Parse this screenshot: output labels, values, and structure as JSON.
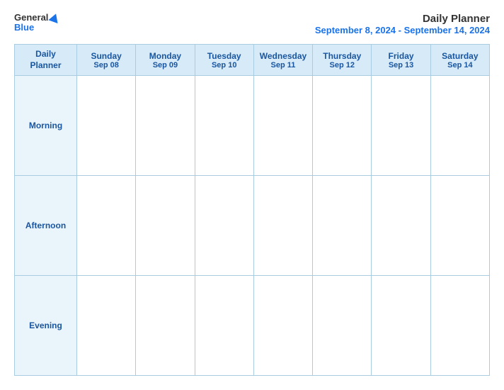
{
  "header": {
    "logo_general": "General",
    "logo_blue": "Blue",
    "title": "Daily Planner",
    "subtitle": "September 8, 2024 - September 14, 2024"
  },
  "table": {
    "col_header": {
      "line1": "Daily",
      "line2": "Planner"
    },
    "days": [
      {
        "name": "Sunday",
        "date": "Sep 08"
      },
      {
        "name": "Monday",
        "date": "Sep 09"
      },
      {
        "name": "Tuesday",
        "date": "Sep 10"
      },
      {
        "name": "Wednesday",
        "date": "Sep 11"
      },
      {
        "name": "Thursday",
        "date": "Sep 12"
      },
      {
        "name": "Friday",
        "date": "Sep 13"
      },
      {
        "name": "Saturday",
        "date": "Sep 14"
      }
    ],
    "rows": [
      {
        "label": "Morning"
      },
      {
        "label": "Afternoon"
      },
      {
        "label": "Evening"
      }
    ]
  }
}
